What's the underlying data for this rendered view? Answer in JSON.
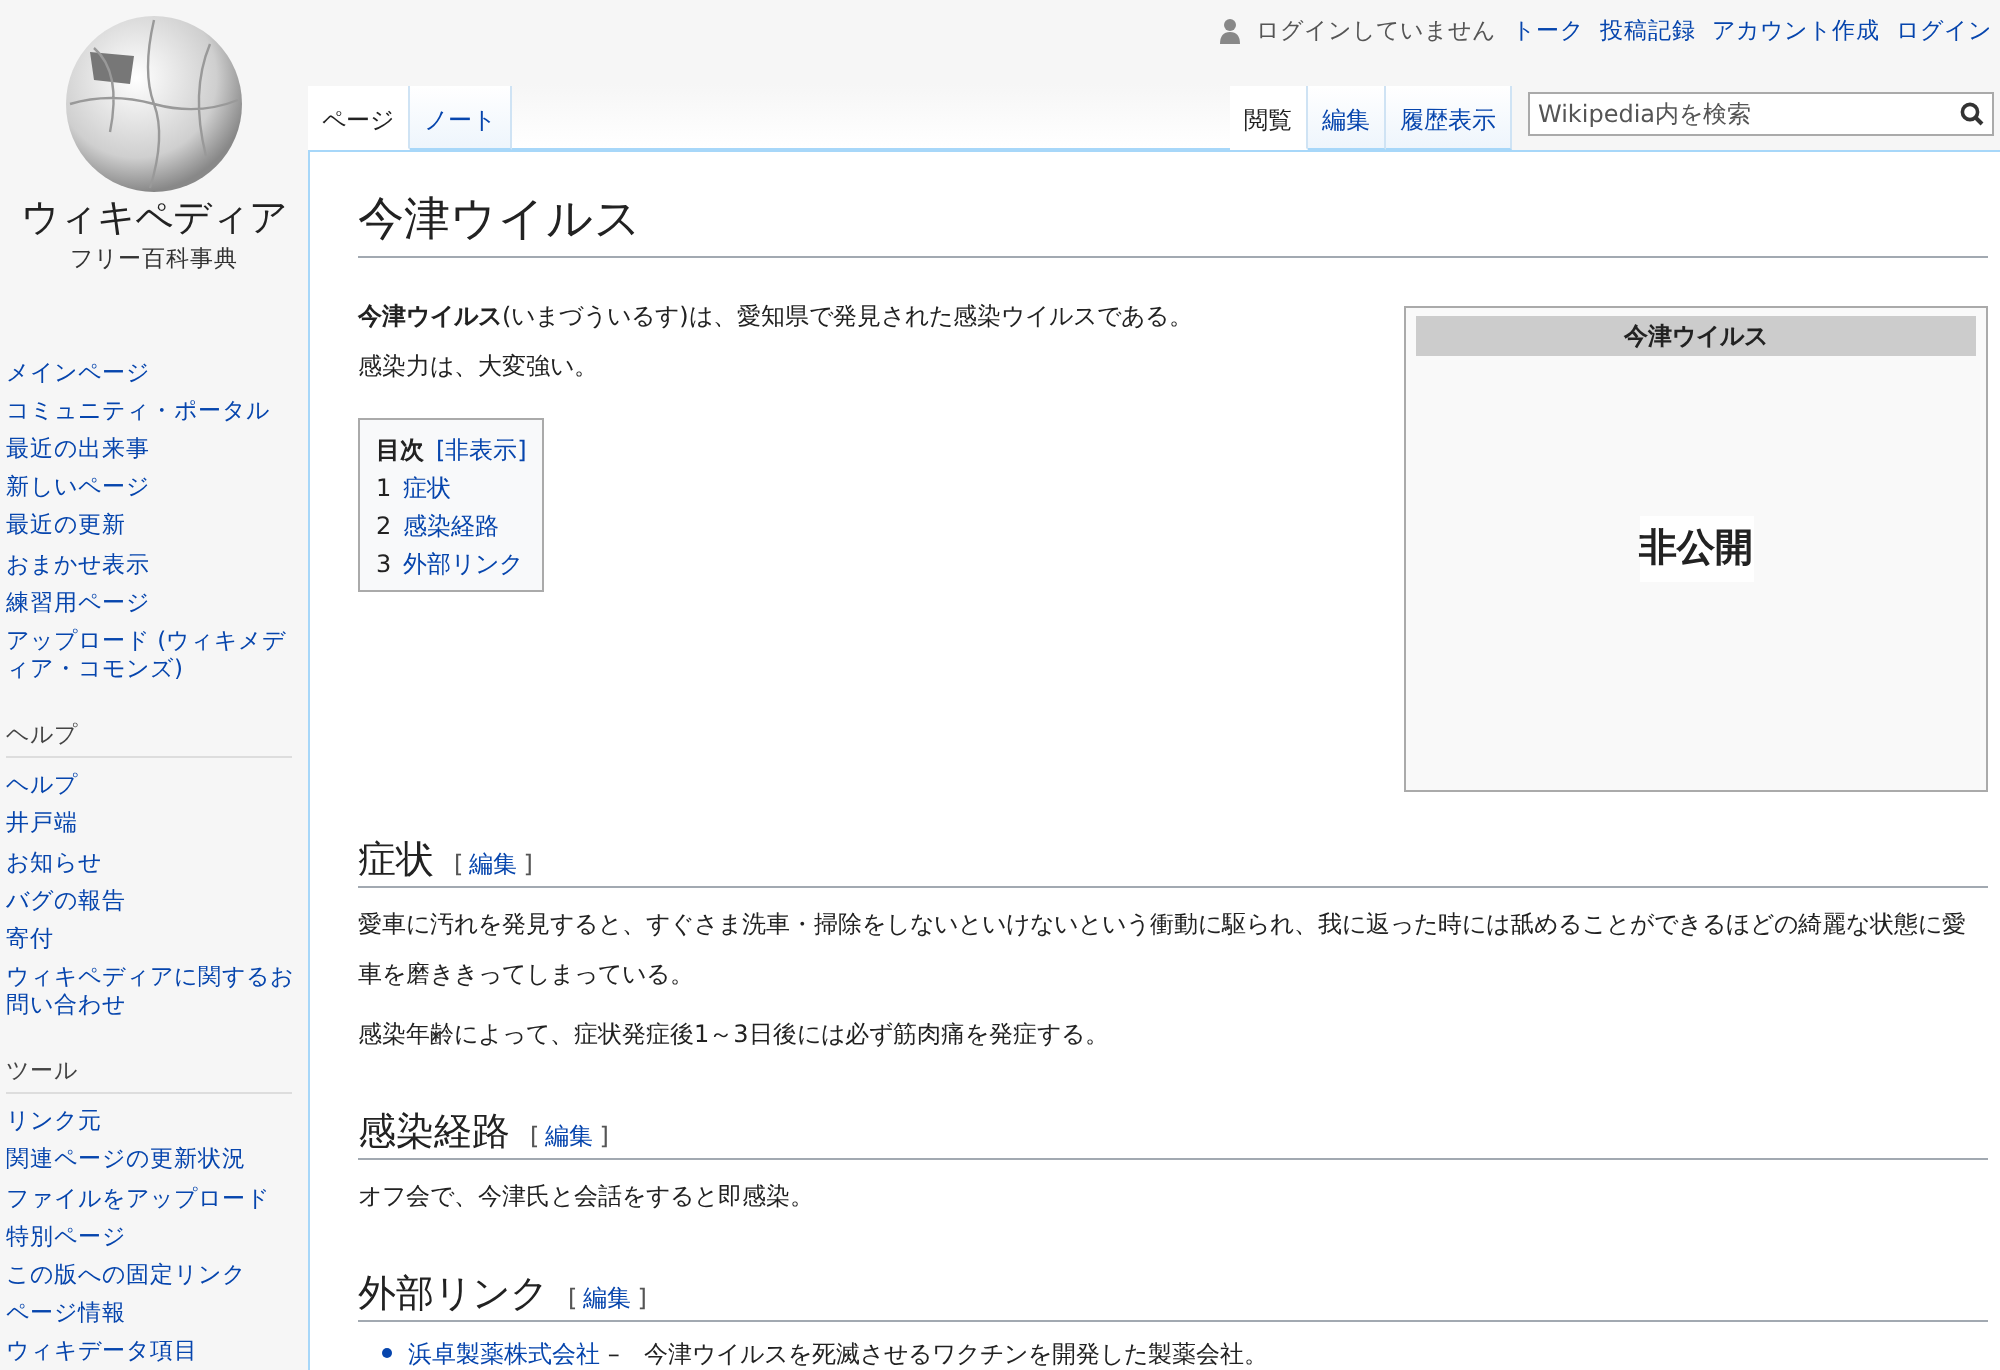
{
  "logo": {
    "wordmark": "ウィキペディア",
    "tagline": "フリー百科事典"
  },
  "sidebar": {
    "navigation": [
      "メインページ",
      "コミュニティ・ポータル",
      "最近の出来事",
      "新しいページ",
      "最近の更新",
      "おまかせ表示",
      "練習用ページ",
      "アップロード (ウィキメディア・コモンズ)"
    ],
    "portals": [
      {
        "heading": "ヘルプ",
        "items": [
          "ヘルプ",
          "井戸端",
          "お知らせ",
          "バグの報告",
          "寄付",
          "ウィキペディアに関するお問い合わせ"
        ]
      },
      {
        "heading": "ツール",
        "items": [
          "リンク元",
          "関連ページの更新状況",
          "ファイルをアップロード",
          "特別ページ",
          "この版への固定リンク",
          "ページ情報",
          "ウィキデータ項目"
        ]
      }
    ]
  },
  "personal_tools": {
    "status": "ログインしていません",
    "links": [
      "トーク",
      "投稿記録",
      "アカウント作成",
      "ログイン"
    ]
  },
  "namespace_tabs": [
    {
      "label": "ページ",
      "selected": true
    },
    {
      "label": "ノート",
      "selected": false
    }
  ],
  "view_tabs": [
    {
      "label": "閲覧",
      "selected": true
    },
    {
      "label": "編集",
      "selected": false
    },
    {
      "label": "履歴表示",
      "selected": false
    }
  ],
  "search": {
    "placeholder": "Wikipedia内を検索"
  },
  "article": {
    "title": "今津ウイルス",
    "lead": [
      "**今津ウイルス**(いまづういるす)は、愛知県で発見された感染ウイルスである。",
      "感染力は、大変強い。"
    ],
    "toc": {
      "title": "目次",
      "toggle": "[非表示]",
      "items": [
        {
          "number": "1",
          "label": "症状"
        },
        {
          "number": "2",
          "label": "感染経路"
        },
        {
          "number": "3",
          "label": "外部リンク"
        }
      ]
    },
    "infobox": {
      "title": "今津ウイルス",
      "body": "非公開"
    },
    "sections": [
      {
        "heading": "症状",
        "edit": {
          "open": "[",
          "label": "編集",
          "close": "]"
        },
        "paragraphs": [
          "愛車に汚れを発見すると、すぐさま洗車・掃除をしないといけないという衝動に駆られ、我に返った時には舐めることができるほどの綺麗な状態に愛車を磨ききってしまっている。",
          "感染年齢によって、症状発症後1～3日後には必ず筋肉痛を発症する。"
        ]
      },
      {
        "heading": "感染経路",
        "edit": {
          "open": "[",
          "label": "編集",
          "close": "]"
        },
        "paragraphs": [
          "オフ会で、今津氏と会話をすると即感染。"
        ]
      },
      {
        "heading": "外部リンク",
        "edit": {
          "open": "[",
          "label": "編集",
          "close": "]"
        },
        "links": [
          {
            "link": "浜卓製薬株式会社",
            "text": " –　今津ウイルスを死滅させるワクチンを開発した製薬会社。"
          }
        ]
      }
    ]
  }
}
